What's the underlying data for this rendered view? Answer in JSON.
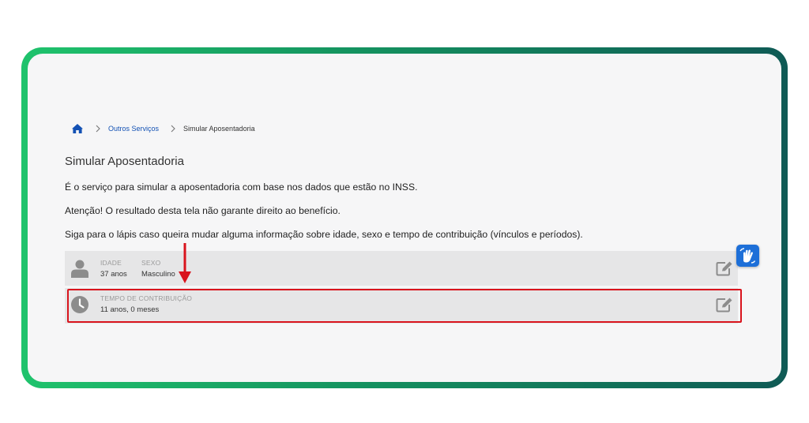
{
  "breadcrumb": {
    "home_icon": "home-icon",
    "items": [
      "Outros Serviços",
      "Simular Aposentadoria"
    ]
  },
  "page": {
    "title": "Simular Aposentadoria",
    "paragraphs": [
      "É o serviço para simular a aposentadoria com base nos dados que estão no INSS.",
      "Atenção! O resultado desta tela não garante direito ao benefício.",
      "Siga para o lápis caso queira mudar alguma informação sobre idade, sexo e tempo de contribuição (vínculos e períodos)."
    ]
  },
  "personal": {
    "idade_label": "IDADE",
    "idade_value": "37 anos",
    "sexo_label": "SEXO",
    "sexo_value": "Masculino"
  },
  "contribution": {
    "label": "TEMPO DE CONTRIBUIÇÃO",
    "value": "11 anos, 0 meses"
  },
  "colors": {
    "frame_gradient": [
      "#1fc36c",
      "#0f5a55"
    ],
    "highlight": "#d9141d",
    "link": "#1351b4",
    "accessibility_button": "#1d6fd8"
  },
  "icons": {
    "user": "user-icon",
    "clock": "clock-icon",
    "edit": "edit-pencil-icon",
    "arrow": "arrow-down-annotation",
    "libras": "hand-sign-language-icon"
  }
}
